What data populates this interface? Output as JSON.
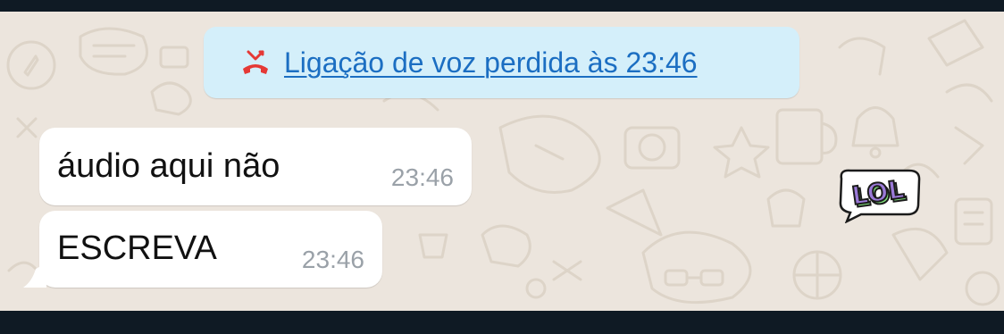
{
  "missed_call": {
    "text": "Ligação de voz perdida às 23:46",
    "icon": "missed-call-icon",
    "color": "#1b6ec2",
    "icon_color": "#e53935"
  },
  "messages": [
    {
      "text": "áudio aqui não",
      "time": "23:46"
    },
    {
      "text": "ESCREVA",
      "time": "23:46"
    }
  ],
  "sticker": {
    "text": "LOL",
    "icon": "lol-sticker"
  },
  "colors": {
    "wallpaper": "#ece5dd",
    "bubble": "#ffffff",
    "system_bubble": "#d4effa",
    "status_bar": "#0f1a24"
  }
}
